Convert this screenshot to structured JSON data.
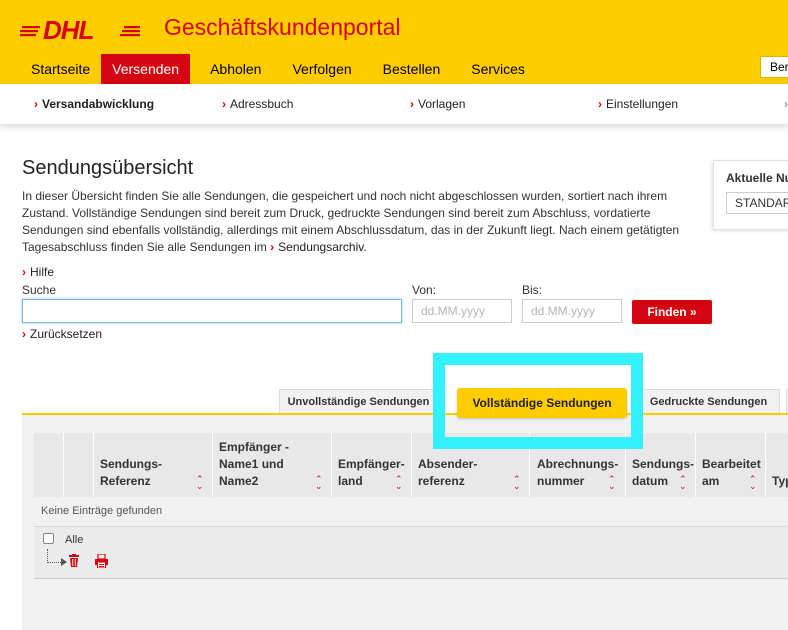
{
  "header": {
    "logo_text": "DHL",
    "portal_title": "Geschäftskundenportal",
    "user_button": "Ber",
    "tabs": [
      {
        "label": "Startseite",
        "active": false
      },
      {
        "label": "Versenden",
        "active": true
      },
      {
        "label": "Abholen",
        "active": false
      },
      {
        "label": "Verfolgen",
        "active": false
      },
      {
        "label": "Bestellen",
        "active": false
      },
      {
        "label": "Services",
        "active": false
      }
    ]
  },
  "subnav": {
    "items": [
      {
        "label": "Versandabwicklung",
        "active": true
      },
      {
        "label": "Adressbuch",
        "active": false
      },
      {
        "label": "Vorlagen",
        "active": false
      },
      {
        "label": "Einstellungen",
        "active": false
      }
    ]
  },
  "page": {
    "title": "Sendungsübersicht",
    "intro": "In dieser Übersicht finden Sie alle Sendungen, die gespeichert und noch nicht abgeschlossen wurden, sortiert nach ihrem Zustand. Vollständige Sendungen sind bereit zum Druck, gedruckte Sendungen sind bereit zum Abschluss, vordatierte Sendungen sind ebenfalls vollständig, allerdings mit einem Abschlussdatum, das in der Zukunft liegt. Nach einem getätigten Tagesabschluss finden Sie alle Sendungen im ",
    "intro_link": "Sendungsarchiv",
    "intro_end": ".",
    "help_link": "Hilfe"
  },
  "search": {
    "label": "Suche",
    "value": "",
    "from_label": "Von:",
    "to_label": "Bis:",
    "date_placeholder": "dd.MM.yyyy",
    "find_button": "Finden",
    "reset_link": "Zurücksetzen"
  },
  "right_panel": {
    "title": "Aktuelle Nu",
    "select_value": "STANDAR"
  },
  "status_tabs": [
    {
      "label": "Unvollständige Sendungen",
      "active": false
    },
    {
      "label": "Vollständige Sendungen",
      "active": true
    },
    {
      "label": "Gedruckte Sendungen",
      "active": false
    }
  ],
  "table": {
    "columns": [
      {
        "l1": "",
        "l2": "Sendungs-",
        "l3": "Referenz"
      },
      {
        "l1": "Empfänger -",
        "l2": "Name1 und",
        "l3": "Name2"
      },
      {
        "l1": "",
        "l2": "Empfänger-",
        "l3": "land"
      },
      {
        "l1": "",
        "l2": "Absender-",
        "l3": "referenz"
      },
      {
        "l1": "",
        "l2": "Abrechnungs-",
        "l3": "nummer"
      },
      {
        "l1": "",
        "l2": "Sendungs-",
        "l3": "datum"
      },
      {
        "l1": "",
        "l2": "Bearbeitet",
        "l3": "am"
      },
      {
        "l1": "",
        "l2": "",
        "l3": "Typ"
      }
    ],
    "empty_message": "Keine Einträge gefunden",
    "select_all_label": "Alle"
  },
  "colors": {
    "brand_yellow": "#ffcc00",
    "brand_red": "#d40511",
    "highlight": "#33f0ff"
  },
  "icons": [
    "chevron-right-icon",
    "double-chevron-icon",
    "sort-icon",
    "trash-icon",
    "print-icon"
  ]
}
